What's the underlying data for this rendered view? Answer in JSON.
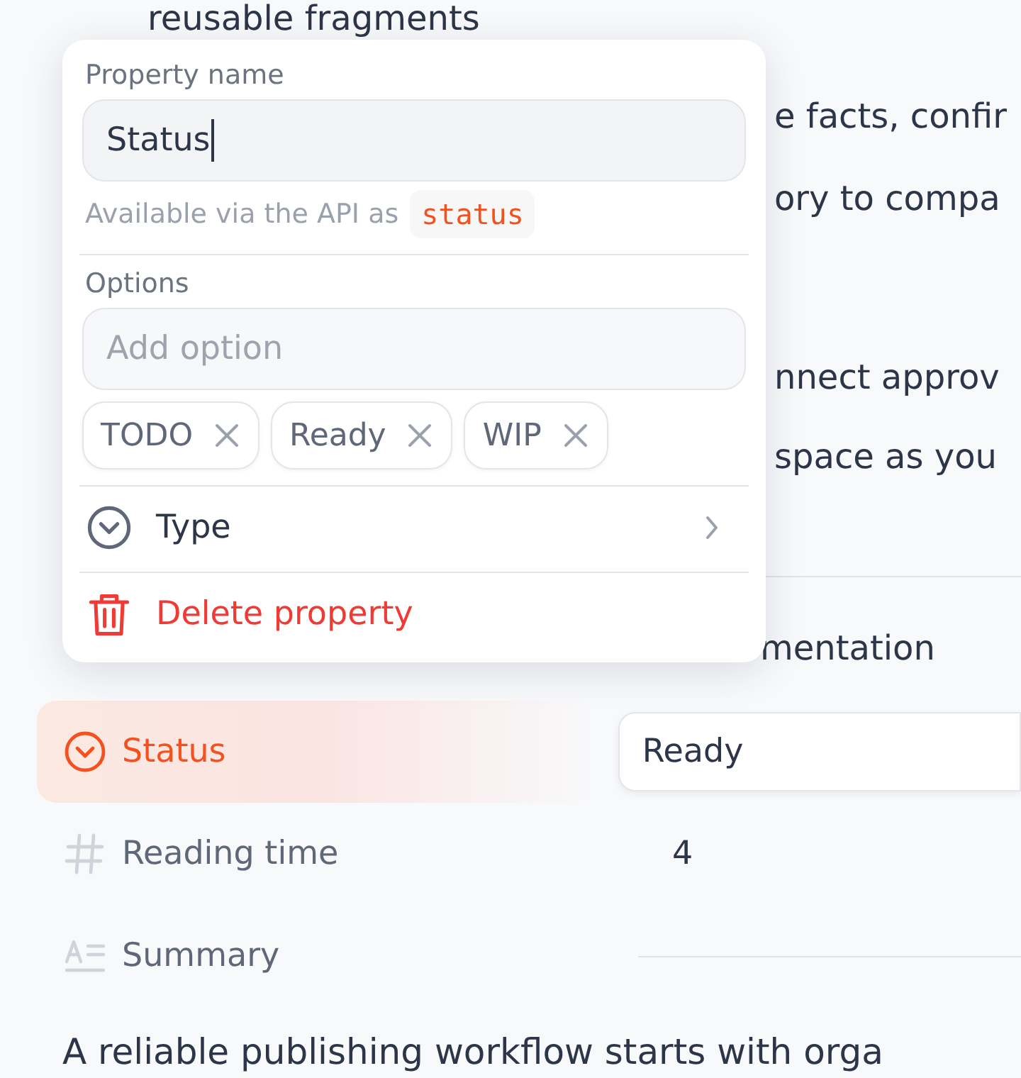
{
  "background": {
    "fragments": [
      "reusable fragments",
      "e facts, confir",
      "ory to compa",
      "nnect approv",
      "space as you",
      "mentation"
    ],
    "properties": [
      {
        "kind": "select",
        "label": "Status",
        "value": "Ready",
        "selected": true
      },
      {
        "kind": "number",
        "label": "Reading time",
        "value": "4",
        "selected": false
      },
      {
        "kind": "text",
        "label": "Summary",
        "selected": false
      }
    ],
    "paragraph": "A reliable publishing workflow starts with orga"
  },
  "popup": {
    "name_label": "Property name",
    "name_value": "Status",
    "api_hint": "Available via the API as",
    "api_key": "status",
    "options_label": "Options",
    "option_placeholder": "Add option",
    "options": [
      "TODO",
      "Ready",
      "WIP"
    ],
    "type_label": "Type",
    "delete_label": "Delete property"
  }
}
